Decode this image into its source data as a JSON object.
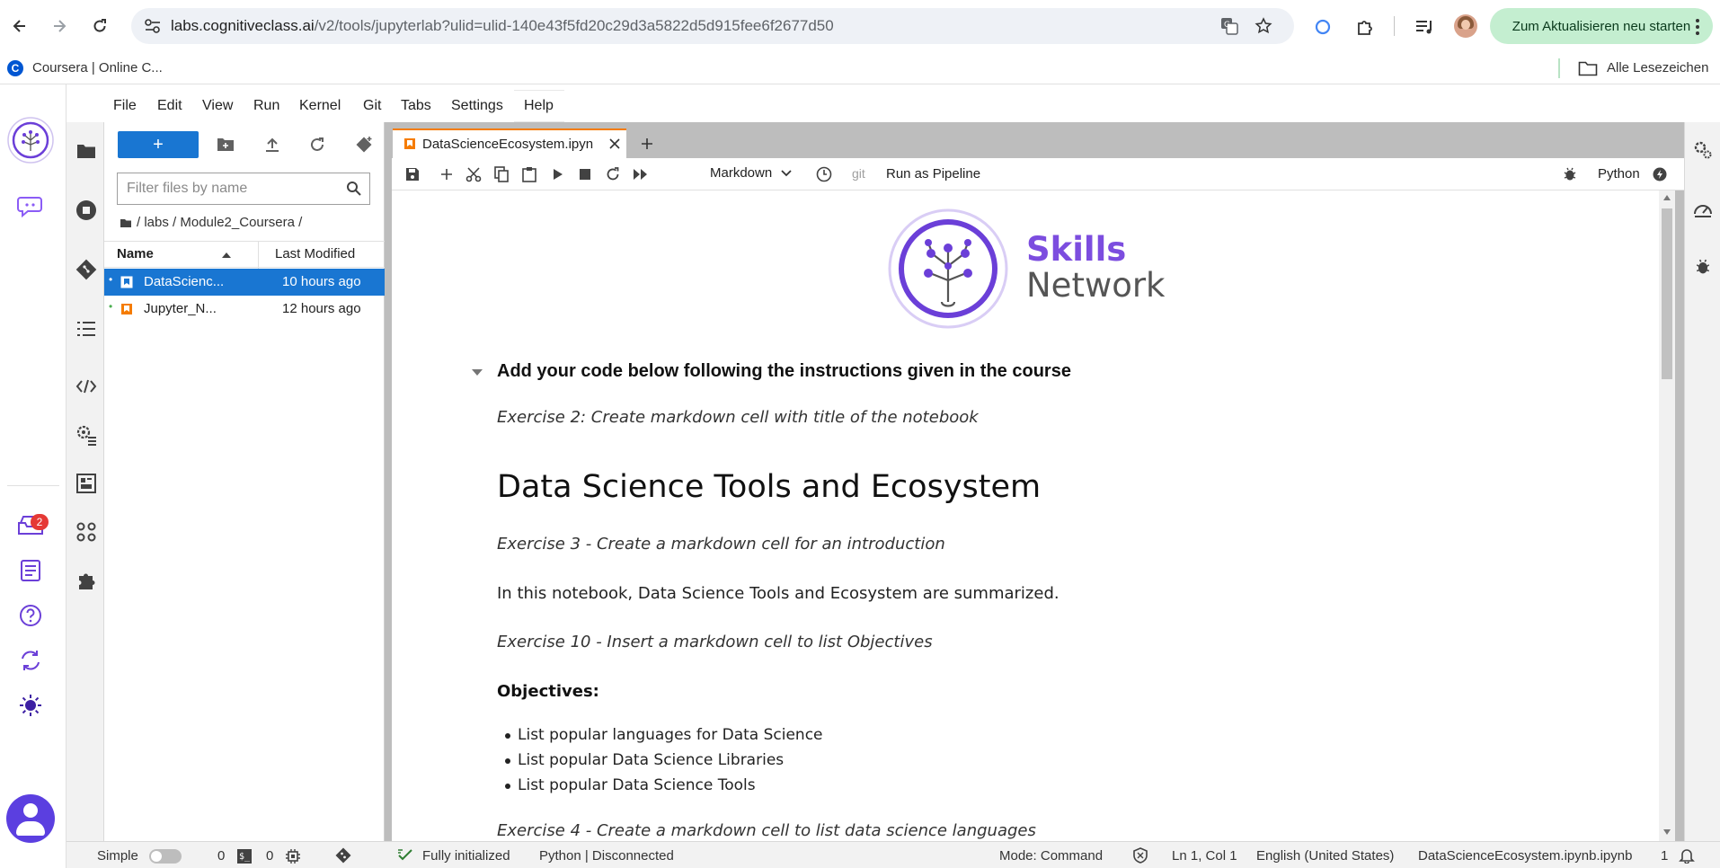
{
  "browser": {
    "url_host": "labs.cognitiveclass.ai",
    "url_path": "/v2/tools/jupyterlab?ulid=ulid-140e43f5fd20c29d3a5822d5d915fee6f2677d50",
    "update_label": "Zum Aktualisieren neu starten",
    "bookmark_label": "Coursera | Online C...",
    "all_bookmarks_label": "Alle Lesezeichen"
  },
  "menu": [
    "File",
    "Edit",
    "View",
    "Run",
    "Kernel",
    "Git",
    "Tabs",
    "Settings",
    "Help"
  ],
  "left_rail": {
    "badge_count": "2"
  },
  "filebrowser": {
    "new_label": "+",
    "filter_placeholder": "Filter files by name",
    "breadcrumb": "/ labs / Module2_Coursera /",
    "col_name": "Name",
    "col_modified": "Last Modified",
    "files": [
      {
        "name": "DataScienc...",
        "modified": "10 hours ago"
      },
      {
        "name": "Jupyter_N...",
        "modified": "12 hours ago"
      }
    ]
  },
  "notebook": {
    "tab_title": "DataScienceEcosystem.ipyn",
    "cell_type": "Markdown",
    "git_label": "git",
    "pipeline_label": "Run as Pipeline",
    "kernel_name": "Python",
    "logo_top": "Skills",
    "logo_bottom": "Network",
    "heading_code": "Add your code below following the instructions given in the course",
    "ex2": "Exercise 2: Create markdown cell with title of the notebook",
    "title": "Data Science Tools and Ecosystem",
    "ex3": "Exercise 3 - Create a markdown cell for an introduction",
    "intro": "In this notebook, Data Science Tools and Ecosystem are summarized.",
    "ex10": "Exercise 10 - Insert a markdown cell to list Objectives",
    "objectives": "Objectives:",
    "bullets": [
      "List popular languages for Data Science",
      "List popular Data Science Libraries",
      "List popular Data Science Tools"
    ],
    "ex4": "Exercise 4 - Create a markdown cell to list data science languages"
  },
  "status": {
    "mode_simple": "Simple",
    "count_a": "0",
    "count_b": "0",
    "init": "Fully initialized",
    "kernel_state": "Python | Disconnected",
    "mode": "Mode: Command",
    "position": "Ln 1, Col 1",
    "language": "English (United States)",
    "filename": "DataScienceEcosystem.ipynb.ipynb",
    "notif_count": "1"
  },
  "colors": {
    "brand_purple": "#6b3fd8",
    "jupyter_orange": "#f57c00",
    "select_blue": "#1976d2",
    "update_green": "#c4eed0"
  }
}
